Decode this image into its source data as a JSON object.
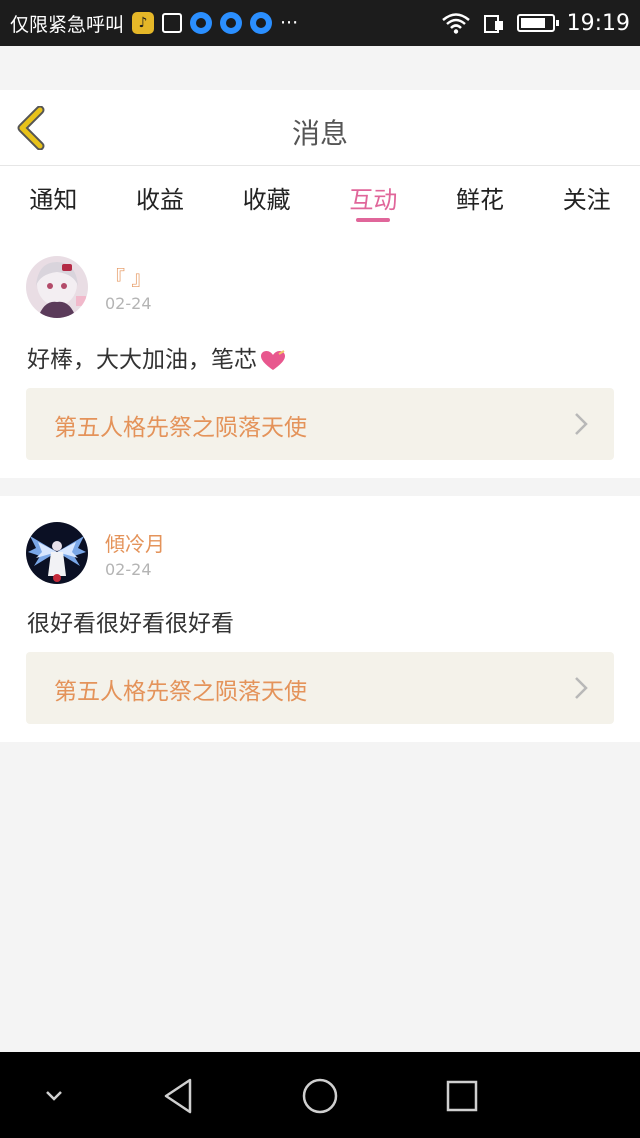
{
  "status_bar": {
    "carrier_text": "仅限紧急呼叫",
    "time": "19:19",
    "icons": [
      "music-app-icon",
      "gallery-icon",
      "qq-icon",
      "qq-icon",
      "qq-icon",
      "more-notifications-icon",
      "wifi-icon",
      "sim-icon",
      "battery-icon"
    ],
    "more": "···"
  },
  "header": {
    "title": "消息",
    "back_icon": "chevron-left-icon"
  },
  "tabs": [
    {
      "label": "通知",
      "active": false
    },
    {
      "label": "收益",
      "active": false
    },
    {
      "label": "收藏",
      "active": false
    },
    {
      "label": "互动",
      "active": true
    },
    {
      "label": "鲜花",
      "active": false
    },
    {
      "label": "关注",
      "active": false
    }
  ],
  "messages": [
    {
      "username": "『 』",
      "date": "02-24",
      "comment": "好棒，大大加油，笔芯",
      "comment_emoji": "heart-icon",
      "work_title": "第五人格先祭之陨落天使"
    },
    {
      "username": "傾冷月",
      "date": "02-24",
      "comment": "很好看很好看很好看",
      "work_title": "第五人格先祭之陨落天使"
    }
  ],
  "system_nav": {
    "icons": [
      "collapse-chevron-icon",
      "back-triangle-icon",
      "home-circle-icon",
      "recents-square-icon"
    ]
  },
  "colors": {
    "accent_pink": "#e0669a",
    "accent_orange": "#e4935a",
    "back_chevron": "#e8c21a",
    "link_bg": "#f4f2ea"
  }
}
